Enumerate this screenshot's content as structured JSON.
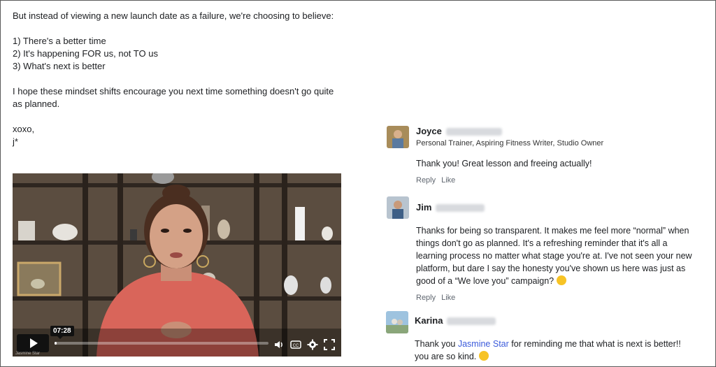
{
  "post": {
    "line1": "But instead of viewing a new launch date as a failure, we're choosing to believe:",
    "list": [
      "1) There's a better time",
      "2) It's happening FOR us, not TO us",
      "3) What's next is better"
    ],
    "para2_a": "I hope these mindset shifts encourage you next time something doesn't go quite",
    "para2_b": "as planned.",
    "signoff": "xoxo,",
    "signature": "j*"
  },
  "video": {
    "time": "07:28",
    "progress_fraction": 0.01,
    "watermark": "Jasmine Star"
  },
  "comments": [
    {
      "name": "Joyce",
      "subtitle": "Personal Trainer, Aspiring Fitness Writer, Studio Owner",
      "text": "Thank you! Great lesson and freeing actually!",
      "reply": "Reply",
      "like": "Like"
    },
    {
      "name": "Jim",
      "text_l1": "Thanks for being so transparent. It makes me feel more “normal” when",
      "text_l2": "things don't go as planned. It's a refreshing reminder that it's all a",
      "text_l3": "learning process no matter what stage you're at. I've not seen your new",
      "text_l4": "platform, but dare I say the honesty you've shown us here was just as",
      "text_l5": "good of a “We love you” campaign?",
      "reply": "Reply",
      "like": "Like"
    },
    {
      "name": "Karina",
      "text_pre": "Thank you ",
      "mention": "Jasmine Star",
      "text_post": " for reminding me that what is next is better!!",
      "text_l2": "you are so kind."
    }
  ],
  "colors": {
    "mention": "#3b5bdb",
    "action_text": "#606770",
    "shirt": "#d9655a"
  },
  "icons": [
    "play-icon",
    "volume-icon",
    "closed-captions-icon",
    "settings-gear-icon",
    "fullscreen-icon"
  ]
}
